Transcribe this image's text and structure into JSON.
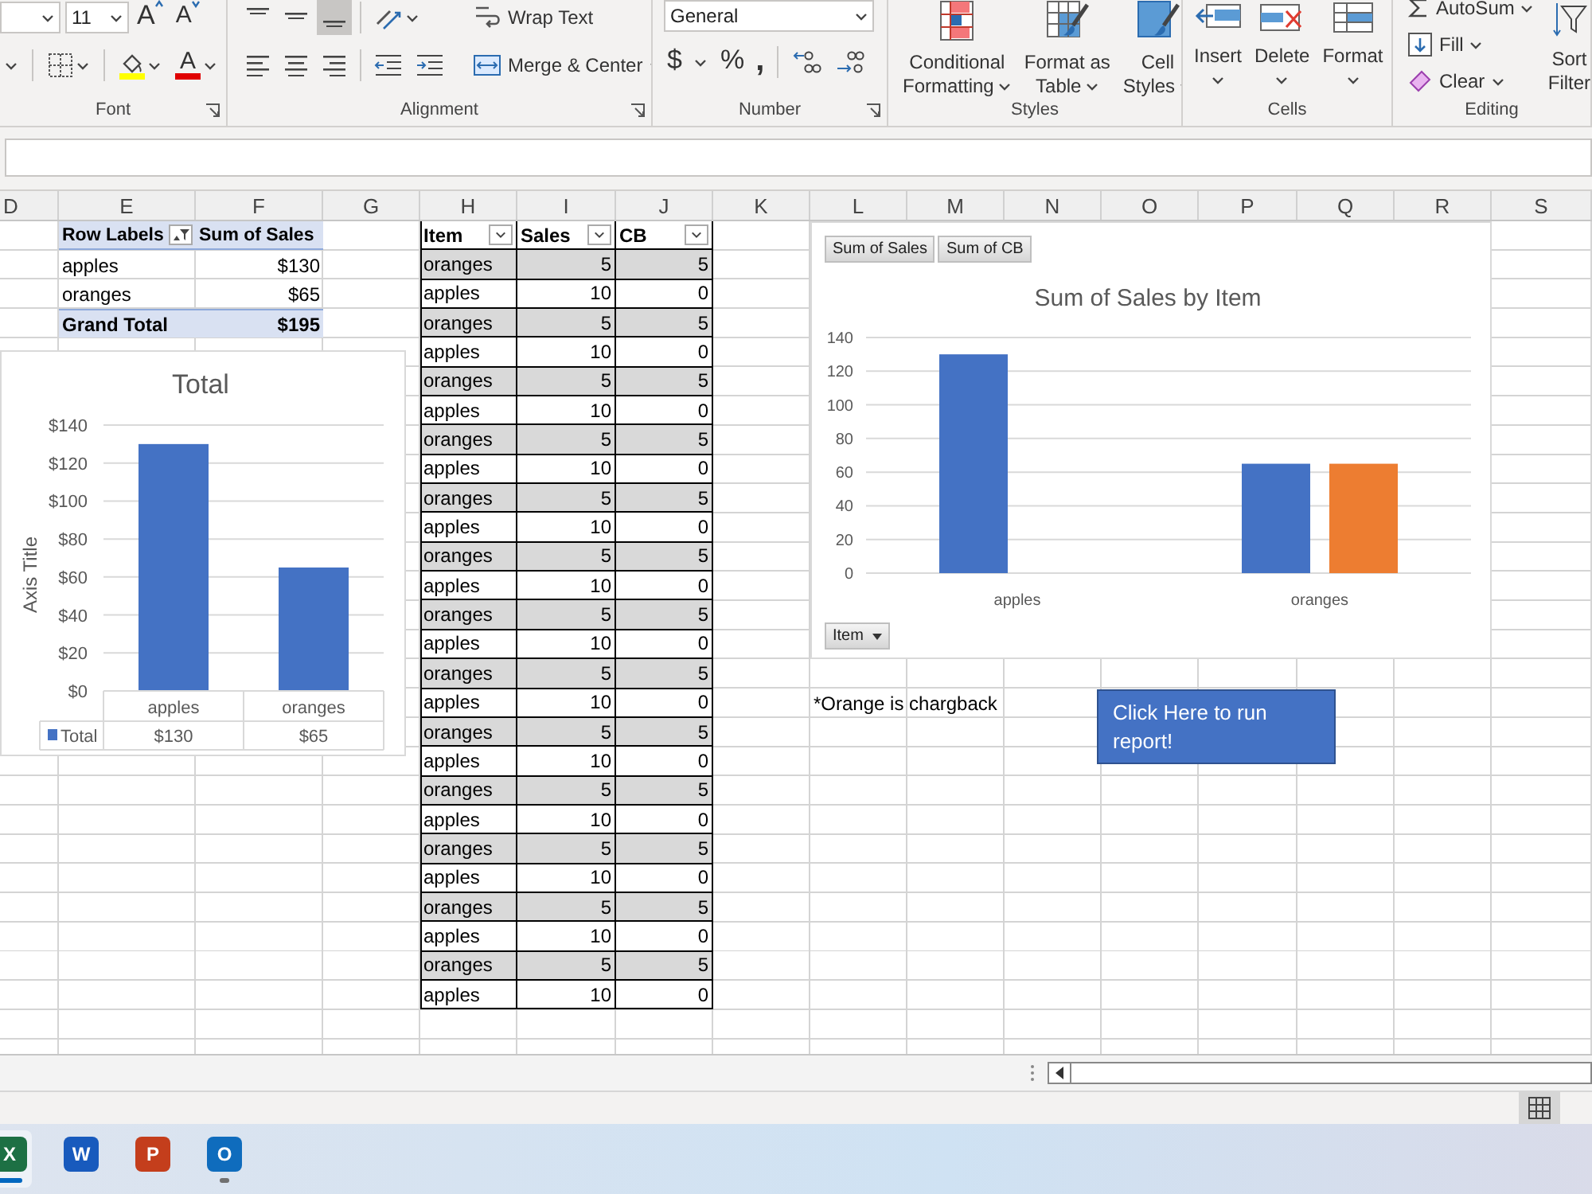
{
  "ribbon": {
    "font": {
      "size": "11",
      "grow_letter": "A",
      "shrink_letter": "A",
      "font_color_letter": "A",
      "label": "Font"
    },
    "alignment": {
      "vertical": [
        {
          "selected": false
        },
        {
          "selected": false
        },
        {
          "selected": true
        }
      ],
      "wrap_text": "Wrap Text",
      "merge": "Merge & Center",
      "label": "Alignment"
    },
    "number": {
      "format": "General",
      "currency": "$",
      "percent": "%",
      "comma": ",",
      "label": "Number"
    },
    "styles": {
      "buttons": [
        {
          "lines": [
            "Conditional",
            "Formatting"
          ]
        },
        {
          "lines": [
            "Format as",
            "Table"
          ]
        },
        {
          "lines": [
            "Cell",
            "Styles"
          ]
        }
      ],
      "label": "Styles"
    },
    "cells": {
      "buttons": [
        "Insert",
        "Delete",
        "Format"
      ],
      "label": "Cells"
    },
    "editing": {
      "autosum": "AutoSum",
      "fill": "Fill",
      "clear": "Clear",
      "sort_lines": [
        "Sort",
        "Filter"
      ],
      "label": "Editing"
    }
  },
  "columns": [
    "D",
    "E",
    "F",
    "G",
    "H",
    "I",
    "J",
    "K",
    "L",
    "M",
    "N",
    "O",
    "P",
    "Q",
    "R",
    "S"
  ],
  "pivot": {
    "headers": [
      "Row Labels",
      "Sum of Sales"
    ],
    "rows": [
      {
        "label": "apples",
        "value": "$130"
      },
      {
        "label": "oranges",
        "value": "$65"
      }
    ],
    "total": {
      "label": "Grand Total",
      "value": "$195"
    }
  },
  "table": {
    "columns": [
      "Item",
      "Sales",
      "CB"
    ],
    "rows": [
      {
        "item": "oranges",
        "sales": "5",
        "cb": "5"
      },
      {
        "item": "apples",
        "sales": "10",
        "cb": "0"
      },
      {
        "item": "oranges",
        "sales": "5",
        "cb": "5"
      },
      {
        "item": "apples",
        "sales": "10",
        "cb": "0"
      },
      {
        "item": "oranges",
        "sales": "5",
        "cb": "5"
      },
      {
        "item": "apples",
        "sales": "10",
        "cb": "0"
      },
      {
        "item": "oranges",
        "sales": "5",
        "cb": "5"
      },
      {
        "item": "apples",
        "sales": "10",
        "cb": "0"
      },
      {
        "item": "oranges",
        "sales": "5",
        "cb": "5"
      },
      {
        "item": "apples",
        "sales": "10",
        "cb": "0"
      },
      {
        "item": "oranges",
        "sales": "5",
        "cb": "5"
      },
      {
        "item": "apples",
        "sales": "10",
        "cb": "0"
      },
      {
        "item": "oranges",
        "sales": "5",
        "cb": "5"
      },
      {
        "item": "apples",
        "sales": "10",
        "cb": "0"
      },
      {
        "item": "oranges",
        "sales": "5",
        "cb": "5"
      },
      {
        "item": "apples",
        "sales": "10",
        "cb": "0"
      },
      {
        "item": "oranges",
        "sales": "5",
        "cb": "5"
      },
      {
        "item": "apples",
        "sales": "10",
        "cb": "0"
      },
      {
        "item": "oranges",
        "sales": "5",
        "cb": "5"
      },
      {
        "item": "apples",
        "sales": "10",
        "cb": "0"
      },
      {
        "item": "oranges",
        "sales": "5",
        "cb": "5"
      },
      {
        "item": "apples",
        "sales": "10",
        "cb": "0"
      },
      {
        "item": "oranges",
        "sales": "5",
        "cb": "5"
      },
      {
        "item": "apples",
        "sales": "10",
        "cb": "0"
      },
      {
        "item": "oranges",
        "sales": "5",
        "cb": "5"
      },
      {
        "item": "apples",
        "sales": "10",
        "cb": "0"
      }
    ]
  },
  "note": "*Orange is chargback",
  "run_button": "Click Here to run report!",
  "left_chart": {
    "chart_data": {
      "type": "bar",
      "title": "Total",
      "ylabel": "Axis Title",
      "categories": [
        "apples",
        "oranges"
      ],
      "series": [
        {
          "name": "Total",
          "color": "#4472c4",
          "values": [
            130,
            65
          ]
        }
      ],
      "grid": true,
      "ylim": [
        0,
        140
      ],
      "yticks": [
        {
          "value": 0,
          "label": "$0"
        },
        {
          "value": 20,
          "label": "$20"
        },
        {
          "value": 40,
          "label": "$40"
        },
        {
          "value": 60,
          "label": "$60"
        },
        {
          "value": 80,
          "label": "$80"
        },
        {
          "value": 100,
          "label": "$100"
        },
        {
          "value": 120,
          "label": "$120"
        },
        {
          "value": 140,
          "label": "$140"
        }
      ]
    },
    "data_table": [
      "$130",
      "$65"
    ]
  },
  "right_chart": {
    "axis_button": "Item",
    "chart_data": {
      "type": "bar",
      "title": "Sum of Sales by Item",
      "categories": [
        "apples",
        "oranges"
      ],
      "series": [
        {
          "name": "Sum of Sales",
          "color": "#4472c4",
          "values": [
            130,
            65
          ]
        },
        {
          "name": "Sum of CB",
          "color": "#ed7d31",
          "values": [
            0,
            65
          ]
        }
      ],
      "grid": true,
      "ylim": [
        0,
        140
      ],
      "yticks": [
        0,
        20,
        40,
        60,
        80,
        100,
        120,
        140
      ]
    }
  },
  "status_bar": {
    "views": [
      {
        "selected": true
      }
    ]
  },
  "taskbar": [
    {
      "letter": "X",
      "color": "#1d7044",
      "active": true,
      "running": true
    },
    {
      "letter": "W",
      "color": "#185abd",
      "active": false,
      "running": false
    },
    {
      "letter": "P",
      "color": "#c43e1c",
      "active": false,
      "running": false
    },
    {
      "letter": "O",
      "color": "#0f6cbd",
      "active": false,
      "running": true
    }
  ]
}
